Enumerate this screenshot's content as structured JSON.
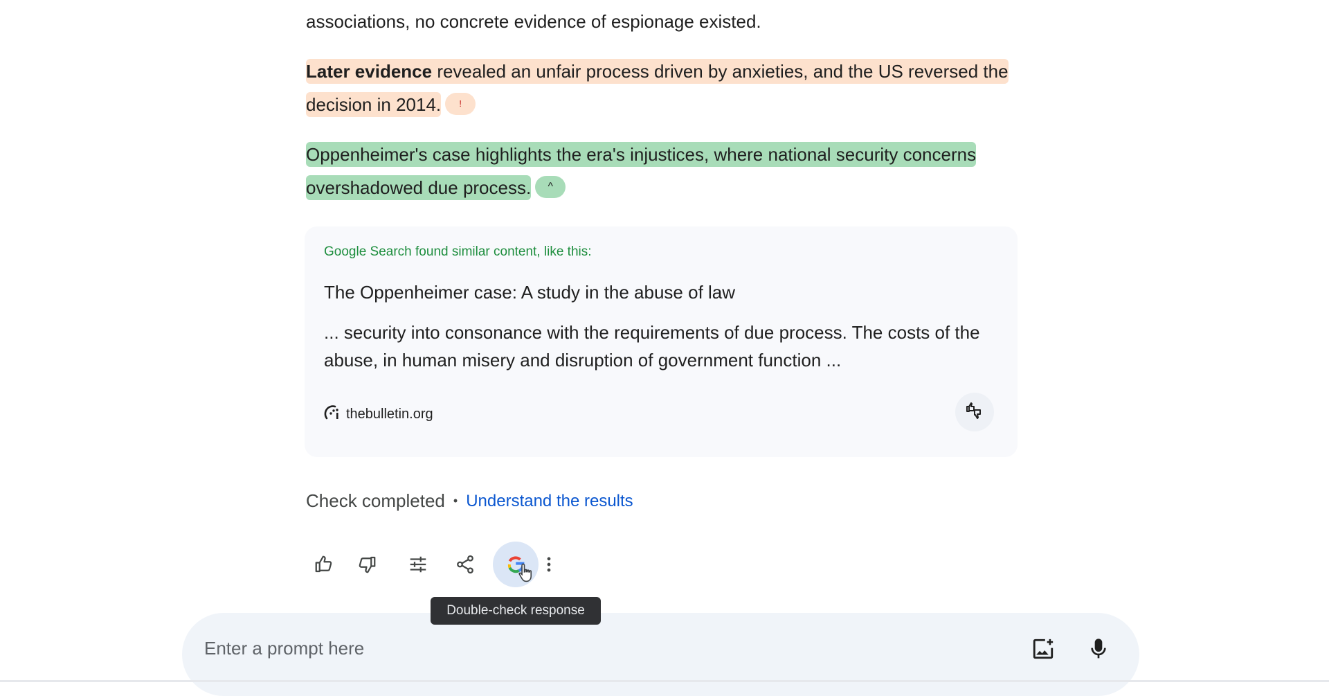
{
  "response": {
    "paragraph_prev_tail": "associations, no concrete evidence of espionage existed.",
    "paragraph_orange": {
      "bold_lead": "Later evidence",
      "text": " revealed an unfair process driven by anxieties, and the US reversed the decision in 2014.",
      "chip_label": "!",
      "highlight_color": "#fde1cd"
    },
    "paragraph_green": {
      "text": "Oppenheimer's case highlights the era's injustices, where national security concerns overshadowed due process.",
      "chip_label": "^",
      "highlight_color": "#a8dcb8"
    }
  },
  "source_card": {
    "heading": "Google Search found similar content, like this:",
    "title": "The Oppenheimer case: A study in the abuse of law",
    "snippet": "... security into consonance with the requirements of due process. The costs of the abuse, in human misery and disruption of government function ...",
    "source_domain": "thebulletin.org",
    "rate_icon": "rate-source-icon"
  },
  "check_status": {
    "status_text": "Check completed",
    "separator": "•",
    "link_label": "Understand the results"
  },
  "actions": [
    {
      "name": "good-response",
      "icon": "thumbs-up-icon"
    },
    {
      "name": "bad-response",
      "icon": "thumbs-down-icon"
    },
    {
      "name": "modify-response",
      "icon": "tune-icon"
    },
    {
      "name": "share",
      "icon": "share-icon"
    },
    {
      "name": "double-check",
      "icon": "google-g-icon"
    },
    {
      "name": "more",
      "icon": "more-vert-icon"
    }
  ],
  "tooltip": "Double-check response",
  "prompt": {
    "placeholder": "Enter a prompt here",
    "value": ""
  },
  "colors": {
    "link": "#0b57d0",
    "heading_green": "#1e8e3e",
    "tooltip_bg": "#303134"
  }
}
